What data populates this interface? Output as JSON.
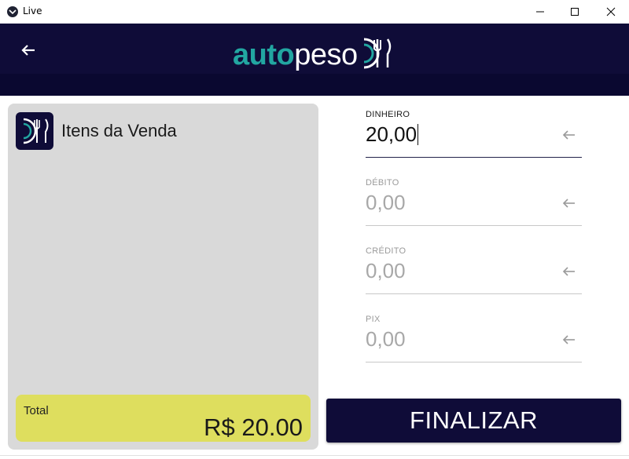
{
  "window": {
    "title": "Live",
    "icon": "app-logo-icon",
    "controls": [
      "minimize-icon",
      "maximize-icon",
      "close-icon"
    ]
  },
  "header": {
    "back_icon": "arrow-left-icon",
    "logo_auto": "auto",
    "logo_peso": "peso",
    "logo_mark_icon": "plate-fork-knife-icon"
  },
  "sale_items": {
    "title": "Itens da Venda",
    "icon": "plate-fork-knife-icon",
    "total_label": "Total",
    "total_value": "R$ 20.00"
  },
  "payments": [
    {
      "label": "DINHEIRO",
      "value": "20,00",
      "active": true,
      "icon": "arrow-left-icon"
    },
    {
      "label": "DÉBITO",
      "value": "0,00",
      "active": false,
      "icon": "arrow-left-icon"
    },
    {
      "label": "CRÉDITO",
      "value": "0,00",
      "active": false,
      "icon": "arrow-left-icon"
    },
    {
      "label": "PIX",
      "value": "0,00",
      "active": false,
      "icon": "arrow-left-icon"
    }
  ],
  "actions": {
    "finalize_label": "FINALIZAR"
  },
  "colors": {
    "header_bg": "#0f0c38",
    "logo_accent": "#22a6a1",
    "panel_bg": "#d9d9d9",
    "total_bg": "#dede5e",
    "button_bg": "#0f0c38"
  }
}
